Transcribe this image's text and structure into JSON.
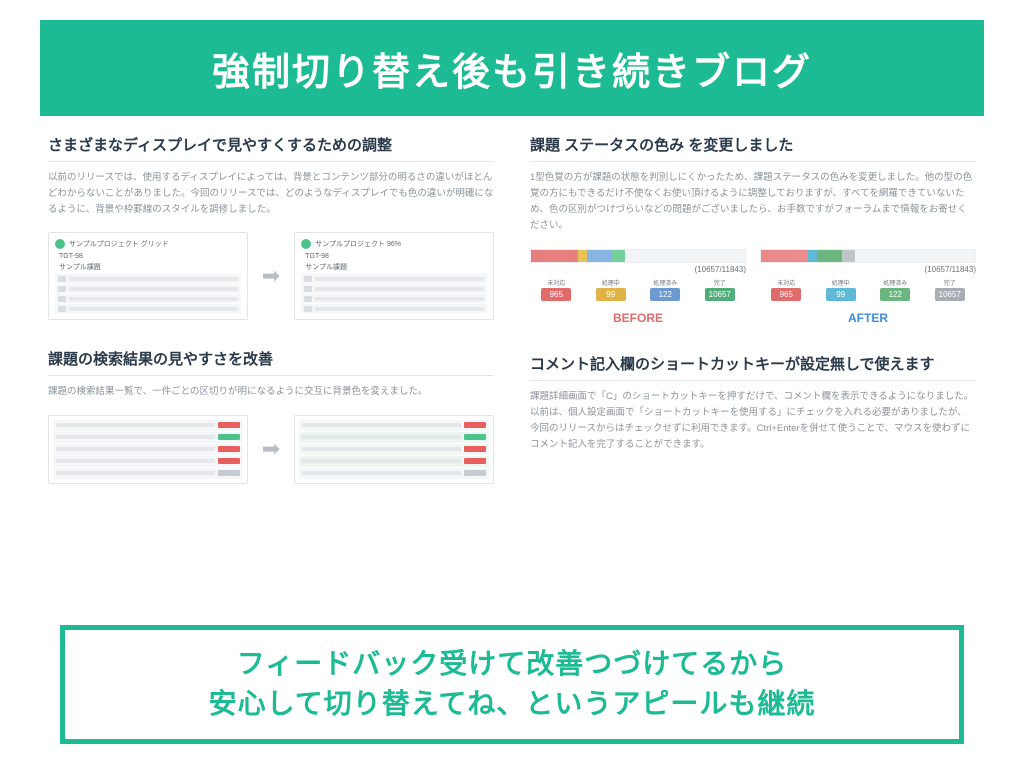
{
  "header": {
    "title": "強制切り替え後も引き続きブログ"
  },
  "left": {
    "a1": {
      "title": "さまざまなディスプレイで見やすくするための調整",
      "body": "以前のリリースでは、使用するディスプレイによっては、背景とコンテンツ部分の明るさの違いがほとんどわからないことがありました。今回のリリースでは、どのようなディスプレイでも色の違いが明確になるように、背景や枠罫線のスタイルを調修しました。",
      "shot1_label": "サンプルプロジェクト グリッド",
      "shot2_label": "サンプルプロジェクト 96%",
      "shot1_sub1": "TGT-98",
      "shot1_sub2": "サンプル課題",
      "shot2_sub1": "TGT-98",
      "shot2_sub2": "サンプル課題"
    },
    "a2": {
      "title": "課題の検索結果の見やすさを改善",
      "body": "課題の検索結果一覧で、一件ごとの区切りが明になるように交互に背景色を変えました。"
    }
  },
  "right": {
    "a1": {
      "title": "課題 ステータスの色み を変更しました",
      "body": "1型色覚の方が課題の状態を判別しにくかったため、課題ステータスの色みを変更しました。他の型の色覚の方にもできるだけ不使なくお使い頂けるように調整しておりますが、すべてを網羅できていないため、色の区別がつけづらいなどの問題がございましたら、お手数ですがフォーラムまで情報をお寄せください。",
      "count": "(10657/11843)",
      "labels": [
        "未対応",
        "処理中",
        "処理済み",
        "完了"
      ],
      "nums": [
        "965",
        "99",
        "122",
        "10657"
      ],
      "before": "BEFORE",
      "after": "AFTER"
    },
    "a2": {
      "title": "コメント記入欄のショートカットキーが設定無しで使えます",
      "body": "課題詳細画面で「C」のショートカットキーを押すだけで、コメント欄を表示できるようになりました。以前は、個人設定画面で「ショートカットキーを使用する」にチェックを入れる必要がありましたが、今回のリリースからはチェックせずに利用できます。Ctrl+Enterを併せて使うことで、マウスを使わずにコメント記入を完了することができます。"
    }
  },
  "footer": {
    "line1": "フィードバック受けて改善つづけてるから",
    "line2": "安心して切り替えてね、というアピールも継続"
  }
}
